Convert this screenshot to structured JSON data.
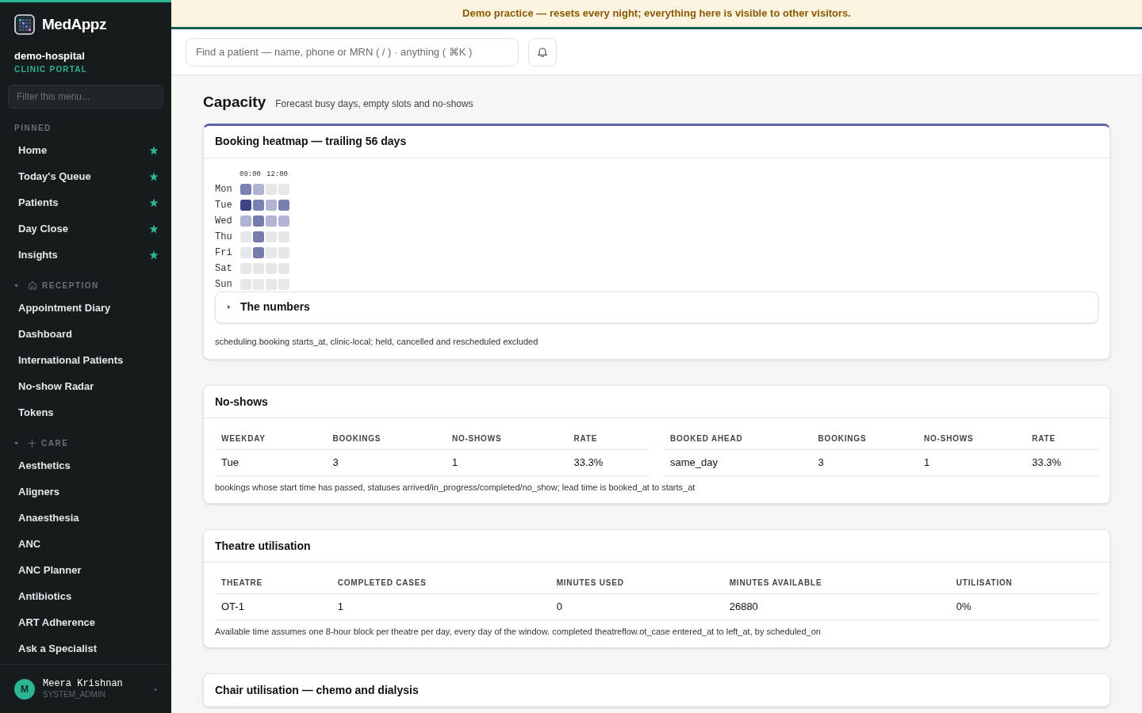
{
  "app": {
    "logo_text": "MedAppz",
    "org": "demo-hospital",
    "portal": "CLINIC PORTAL"
  },
  "sidebar": {
    "filter_placeholder": "Filter this menu...",
    "sections": [
      {
        "kind": "pinned",
        "title": "PINNED",
        "items": [
          {
            "label": "Home",
            "pinned": true
          },
          {
            "label": "Today's Queue",
            "pinned": true
          },
          {
            "label": "Patients",
            "pinned": true
          },
          {
            "label": "Day Close",
            "pinned": true
          },
          {
            "label": "Insights",
            "pinned": true
          }
        ]
      },
      {
        "kind": "reception",
        "title": "RECEPTION",
        "expanded": true,
        "items": [
          {
            "label": "Appointment Diary",
            "pinned": false
          },
          {
            "label": "Dashboard",
            "pinned": false
          },
          {
            "label": "International Patients",
            "pinned": false
          },
          {
            "label": "No-show Radar",
            "pinned": false
          },
          {
            "label": "Tokens",
            "pinned": false
          }
        ]
      },
      {
        "kind": "care",
        "title": "CARE",
        "expanded": true,
        "items": [
          {
            "label": "Aesthetics",
            "pinned": false
          },
          {
            "label": "Aligners",
            "pinned": false
          },
          {
            "label": "Anaesthesia",
            "pinned": false
          },
          {
            "label": "ANC",
            "pinned": false
          },
          {
            "label": "ANC Planner",
            "pinned": false
          },
          {
            "label": "Antibiotics",
            "pinned": false
          },
          {
            "label": "ART Adherence",
            "pinned": false
          },
          {
            "label": "Ask a Specialist",
            "pinned": false
          }
        ]
      }
    ],
    "user": {
      "initial": "M",
      "name": "Meera Krishnan",
      "role": "SYSTEM_ADMIN"
    }
  },
  "banner": "Demo practice — resets every night; everything here is visible to other visitors.",
  "search": {
    "placeholder": "Find a patient — name, phone or MRN ( / ) · anything ( ⌘K )"
  },
  "page": {
    "title": "Capacity",
    "subtitle": "Forecast busy days, empty slots and no-shows"
  },
  "heatmap_card": {
    "title": "Booking heatmap — trailing 56 days",
    "hour_labels": [
      "09:00",
      "12:00"
    ],
    "rows": [
      {
        "day": "Mon",
        "cells": [
          {
            "color": "#7b80b3"
          },
          {
            "color": "#b0b3d1"
          },
          {
            "color": "#e6e7eb"
          },
          {
            "color": "#e6e7eb"
          }
        ]
      },
      {
        "day": "Tue",
        "cells": [
          {
            "color": "#3d4488"
          },
          {
            "color": "#7b80b3"
          },
          {
            "color": "#b0b3d1"
          },
          {
            "color": "#7b80b3"
          }
        ]
      },
      {
        "day": "Wed",
        "cells": [
          {
            "color": "#b0b3d1"
          },
          {
            "color": "#777caf"
          },
          {
            "color": "#b0b3d1"
          },
          {
            "color": "#b0b3d1"
          }
        ]
      },
      {
        "day": "Thu",
        "cells": [
          {
            "color": "#e6e7eb"
          },
          {
            "color": "#777caf"
          },
          {
            "color": "#e6e7eb"
          },
          {
            "color": "#e6e7eb"
          }
        ]
      },
      {
        "day": "Fri",
        "cells": [
          {
            "color": "#e6e7eb"
          },
          {
            "color": "#777caf"
          },
          {
            "color": "#e6e7eb"
          },
          {
            "color": "#e6e7eb"
          }
        ]
      },
      {
        "day": "Sat",
        "cells": [
          {
            "color": "#e6e7eb"
          },
          {
            "color": "#e6e7eb"
          },
          {
            "color": "#e6e7eb"
          },
          {
            "color": "#e6e7eb"
          }
        ]
      },
      {
        "day": "Sun",
        "cells": [
          {
            "color": "#e6e7eb"
          },
          {
            "color": "#e6e7eb"
          },
          {
            "color": "#e6e7eb"
          },
          {
            "color": "#e6e7eb"
          }
        ]
      }
    ],
    "details": {
      "label": "The numbers",
      "expanded": false
    },
    "note": "scheduling.booking starts_at, clinic-local; held, cancelled and rescheduled excluded"
  },
  "cards": [
    {
      "title": "No-shows",
      "tables": [
        {
          "columns": [
            "WEEKDAY",
            "BOOKINGS",
            "NO-SHOWS",
            "RATE"
          ],
          "rows": [
            [
              "Tue",
              "3",
              "1",
              "33.3%"
            ]
          ]
        },
        {
          "columns": [
            "BOOKED AHEAD",
            "BOOKINGS",
            "NO-SHOWS",
            "RATE"
          ],
          "rows": [
            [
              "same_day",
              "3",
              "1",
              "33.3%"
            ]
          ]
        }
      ],
      "note": "bookings whose start time has passed, statuses arrived/in_progress/completed/no_show; lead time is booked_at to starts_at"
    },
    {
      "title": "Theatre utilisation",
      "tables": [
        {
          "columns": [
            "THEATRE",
            "COMPLETED CASES",
            "MINUTES USED",
            "MINUTES AVAILABLE",
            "UTILISATION"
          ],
          "rows": [
            [
              "OT-1",
              "1",
              "0",
              "26880",
              "0%"
            ]
          ]
        }
      ],
      "note": "Available time assumes one 8-hour block per theatre per day, every day of the window. completed theatreflow.ot_case entered_at to left_at, by scheduled_on"
    },
    {
      "title": "Chair utilisation — chemo and dialysis"
    }
  ]
}
